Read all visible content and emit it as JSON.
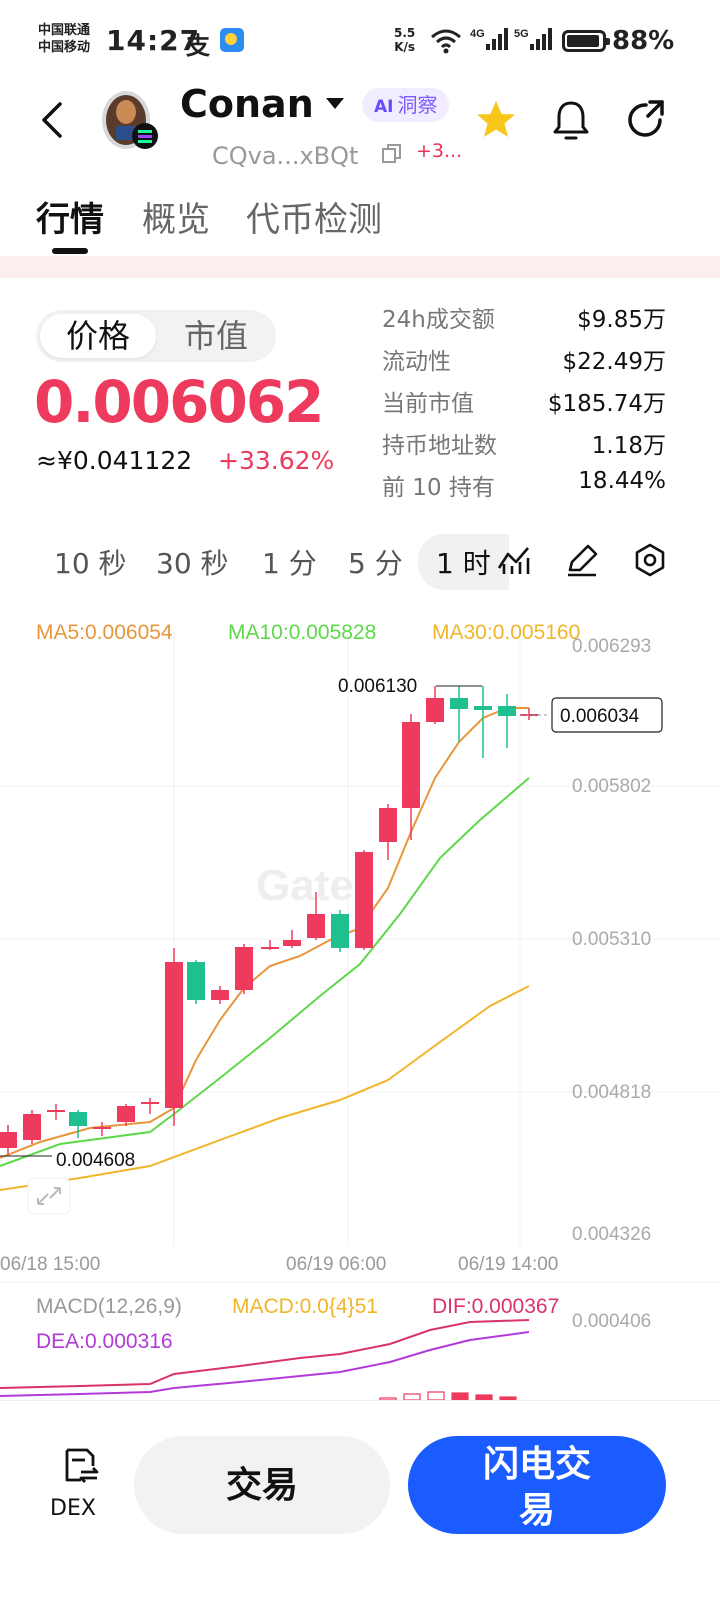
{
  "status_bar": {
    "carrier_1": "中国联通",
    "carrier_2": "中国移动",
    "time": "14:27",
    "alipay_glyph": "支",
    "net_speed_value": "5.5",
    "net_speed_unit": "K/s",
    "signal_1": "4G",
    "signal_2": "5G",
    "battery": "88%"
  },
  "header": {
    "coin_name": "Conan",
    "ai_badge_prefix": "AI",
    "ai_badge": "洞察",
    "address": "CQva...xBQt",
    "chains": "+3..."
  },
  "tabs": [
    "行情",
    "概览",
    "代币检测"
  ],
  "price_toggle": [
    "价格",
    "市值"
  ],
  "price": {
    "value": "0.006062",
    "cny": "≈¥0.041122",
    "change": "+33.62%"
  },
  "stats": [
    {
      "label": "24h成交额",
      "value": "$9.85万"
    },
    {
      "label": "流动性",
      "value": "$22.49万"
    },
    {
      "label": "当前市值",
      "value": "$185.74万"
    },
    {
      "label": "持币地址数",
      "value": "1.18万"
    },
    {
      "label": "前 10 持有",
      "value": "18.44%"
    }
  ],
  "intervals": [
    "10 秒",
    "30 秒",
    "1 分",
    "5 分",
    "1 时"
  ],
  "chart": {
    "ma5_label": "MA5:0.006054",
    "ma10_label": "MA10:0.005828",
    "ma30_label": "MA30:0.005160",
    "y_ticks": [
      "0.006293",
      "0.005802",
      "0.005310",
      "0.004818",
      "0.004326"
    ],
    "x_ticks": [
      "06/18 15:00",
      "06/19 06:00",
      "06/19 14:00"
    ],
    "high_label": "0.006130",
    "low_label": "0.004608",
    "current_price_label": "0.006034",
    "watermark": "Gate",
    "macd_title": "MACD(12,26,9)",
    "macd_value": "MACD:0.0{4}51",
    "dif_value": "DIF:0.000367",
    "dea_value": "DEA:0.000316",
    "macd_tick": "0.000406",
    "colors": {
      "up": "#ee3a5d",
      "down": "#1fbf8f",
      "ma5": "#e8963c",
      "ma10": "#5ed84a",
      "ma30": "#f0b52a",
      "dif": "#d9336b",
      "dea": "#b23ad9"
    }
  },
  "bottom": {
    "dex_label": "DEX",
    "trade_label": "交易",
    "flash_label_line1": "闪电交",
    "flash_label_line2": "易"
  }
}
